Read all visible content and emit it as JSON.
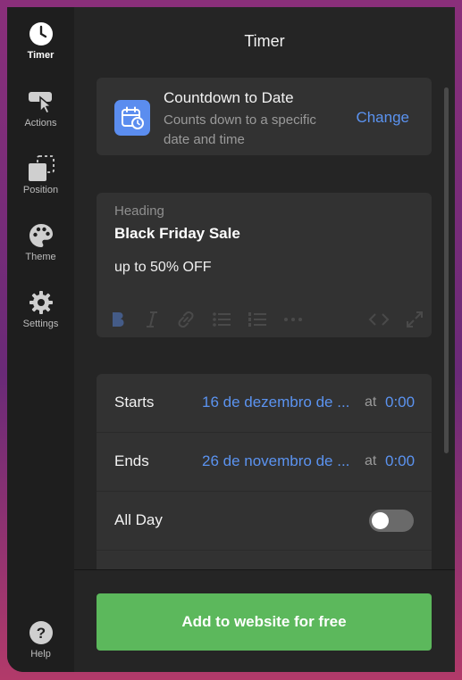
{
  "sidebar": {
    "items": [
      {
        "label": "Timer",
        "icon": "clock-icon"
      },
      {
        "label": "Actions",
        "icon": "cursor-click-icon"
      },
      {
        "label": "Position",
        "icon": "position-icon"
      },
      {
        "label": "Theme",
        "icon": "palette-icon"
      },
      {
        "label": "Settings",
        "icon": "gear-icon"
      }
    ],
    "help": {
      "label": "Help",
      "icon": "help-icon"
    }
  },
  "header": {
    "title": "Timer"
  },
  "countdown": {
    "icon": "calendar-clock-icon",
    "title": "Countdown to Date",
    "description": "Counts down to a specific date and time",
    "change_label": "Change"
  },
  "heading_block": {
    "label": "Heading",
    "heading": "Black Friday Sale",
    "body": "up to 50% OFF"
  },
  "schedule": {
    "starts": {
      "label": "Starts",
      "date": "16 de dezembro de ...",
      "at": "at",
      "time": "0:00"
    },
    "ends": {
      "label": "Ends",
      "date": "26 de novembro de ...",
      "at": "at",
      "time": "0:00"
    },
    "all_day": {
      "label": "All Day",
      "enabled": false
    }
  },
  "footer": {
    "cta_label": "Add to website for free"
  },
  "colors": {
    "accent": "#5b93f0",
    "cta": "#5cb85c",
    "icon_bg": "#5b8def"
  }
}
